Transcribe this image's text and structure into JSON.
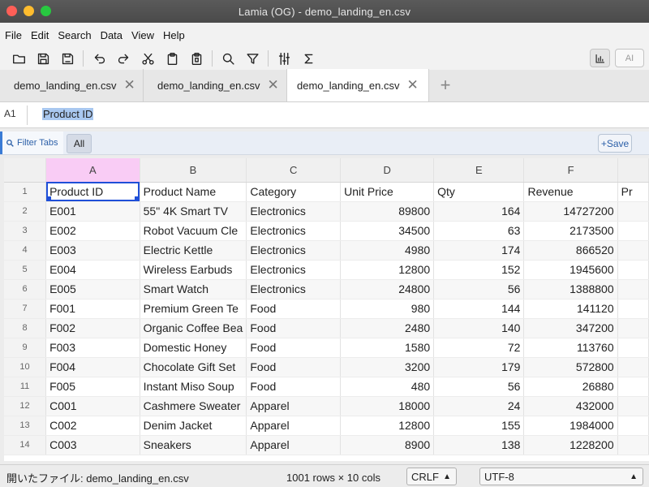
{
  "window": {
    "title": "Lamia (OG) - demo_landing_en.csv"
  },
  "menu": [
    "File",
    "Edit",
    "Search",
    "Data",
    "View",
    "Help"
  ],
  "toolbar": {
    "ai_label": "AI"
  },
  "tabs": [
    {
      "label": "demo_landing_en.csv",
      "active": false
    },
    {
      "label": "demo_landing_en.csv",
      "active": false
    },
    {
      "label": "demo_landing_en.csv",
      "active": true
    }
  ],
  "formula": {
    "cell_ref": "A1",
    "value": "Product ID"
  },
  "filter": {
    "button_label": "Filter Tabs",
    "all_label": "All",
    "save_label": "+Save"
  },
  "grid": {
    "columns": [
      "A",
      "B",
      "C",
      "D",
      "E",
      "F"
    ],
    "selected_column": "A",
    "rows": [
      {
        "n": "1",
        "cells": [
          "Product ID",
          "Product Name",
          "Category",
          "Unit Price",
          "Qty",
          "Revenue",
          "Pr"
        ]
      },
      {
        "n": "2",
        "cells": [
          "E001",
          "55\" 4K Smart TV",
          "Electronics",
          "89800",
          "164",
          "14727200",
          ""
        ]
      },
      {
        "n": "3",
        "cells": [
          "E002",
          "Robot Vacuum Cle",
          "Electronics",
          "34500",
          "63",
          "2173500",
          ""
        ]
      },
      {
        "n": "4",
        "cells": [
          "E003",
          "Electric Kettle",
          "Electronics",
          "4980",
          "174",
          "866520",
          ""
        ]
      },
      {
        "n": "5",
        "cells": [
          "E004",
          "Wireless Earbuds",
          "Electronics",
          "12800",
          "152",
          "1945600",
          ""
        ]
      },
      {
        "n": "6",
        "cells": [
          "E005",
          "Smart Watch",
          "Electronics",
          "24800",
          "56",
          "1388800",
          ""
        ]
      },
      {
        "n": "7",
        "cells": [
          "F001",
          "Premium Green Te",
          "Food",
          "980",
          "144",
          "141120",
          ""
        ]
      },
      {
        "n": "8",
        "cells": [
          "F002",
          "Organic Coffee Bea",
          "Food",
          "2480",
          "140",
          "347200",
          ""
        ]
      },
      {
        "n": "9",
        "cells": [
          "F003",
          "Domestic Honey",
          "Food",
          "1580",
          "72",
          "113760",
          ""
        ]
      },
      {
        "n": "10",
        "cells": [
          "F004",
          "Chocolate Gift Set",
          "Food",
          "3200",
          "179",
          "572800",
          ""
        ]
      },
      {
        "n": "11",
        "cells": [
          "F005",
          "Instant Miso Soup",
          "Food",
          "480",
          "56",
          "26880",
          ""
        ]
      },
      {
        "n": "12",
        "cells": [
          "C001",
          "Cashmere Sweater",
          "Apparel",
          "18000",
          "24",
          "432000",
          ""
        ]
      },
      {
        "n": "13",
        "cells": [
          "C002",
          "Denim Jacket",
          "Apparel",
          "12800",
          "155",
          "1984000",
          ""
        ]
      },
      {
        "n": "14",
        "cells": [
          "C003",
          "Sneakers",
          "Apparel",
          "8900",
          "138",
          "1228200",
          ""
        ]
      }
    ]
  },
  "status": {
    "opened_file": "開いたファイル: demo_landing_en.csv",
    "dimensions": "1001 rows × 10 cols",
    "line_ending": "CRLF",
    "encoding": "UTF-8"
  },
  "colors": {
    "accent": "#1f4fd8",
    "selected_column": "#f9ccf5",
    "formula_highlight": "#a9c8f0"
  }
}
